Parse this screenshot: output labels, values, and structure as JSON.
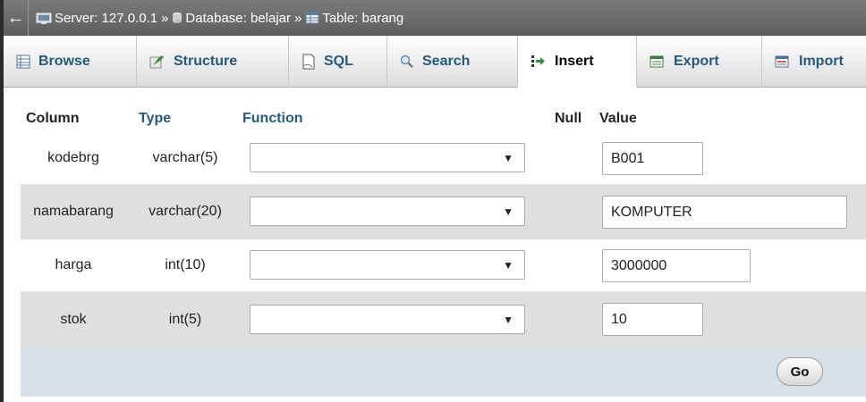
{
  "breadcrumb": {
    "back": "←",
    "server": "Server: 127.0.0.1",
    "database": "Database: belajar",
    "table": "Table: barang",
    "separator": "»"
  },
  "tabs": [
    {
      "label": "Browse",
      "icon": "browse-icon"
    },
    {
      "label": "Structure",
      "icon": "structure-icon"
    },
    {
      "label": "SQL",
      "icon": "sql-icon"
    },
    {
      "label": "Search",
      "icon": "search-icon"
    },
    {
      "label": "Insert",
      "icon": "insert-icon",
      "active": true
    },
    {
      "label": "Export",
      "icon": "export-icon"
    },
    {
      "label": "Import",
      "icon": "import-icon"
    }
  ],
  "headers": {
    "column": "Column",
    "type": "Type",
    "function": "Function",
    "null": "Null",
    "value": "Value"
  },
  "rows": [
    {
      "column": "kodebrg",
      "type": "varchar(5)",
      "function": "",
      "value": "B001"
    },
    {
      "column": "namabarang",
      "type": "varchar(20)",
      "function": "",
      "value": "KOMPUTER"
    },
    {
      "column": "harga",
      "type": "int(10)",
      "function": "",
      "value": "3000000"
    },
    {
      "column": "stok",
      "type": "int(5)",
      "function": "",
      "value": "10"
    }
  ],
  "select_arrow": "▼",
  "go_label": "Go",
  "colors": {
    "tab_text": "#235a81",
    "header_type_function": "#235a81",
    "row_alt": "#dfdfdf",
    "footer": "#d6e0e7"
  }
}
